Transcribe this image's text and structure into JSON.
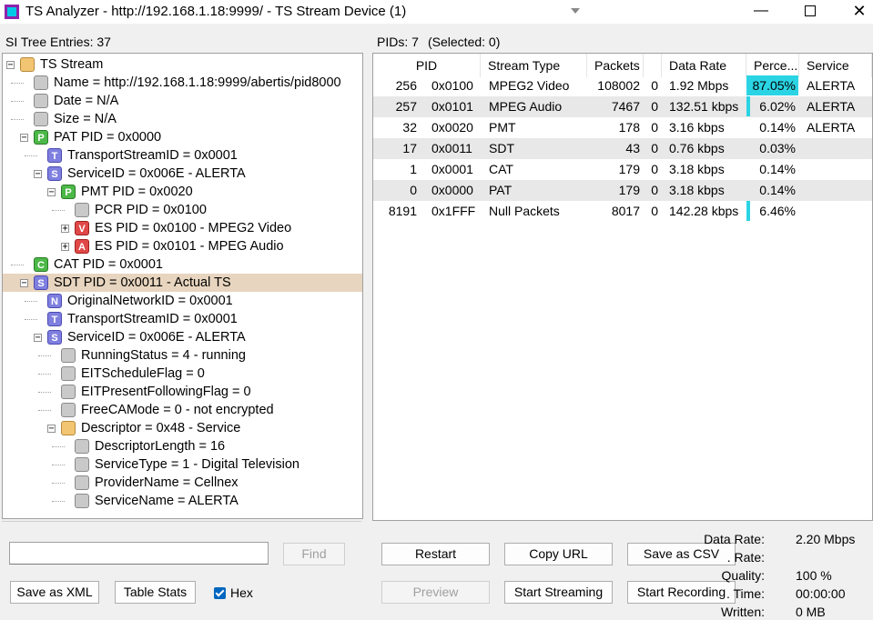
{
  "window": {
    "title": "TS Analyzer - http://192.168.1.18:9999/ - TS Stream Device (1)"
  },
  "left_header": "SI Tree Entries: 37",
  "right_header": {
    "pids": "PIDs: 7",
    "selected": "(Selected: 0)"
  },
  "tree": {
    "items": [
      {
        "label": "TS Stream",
        "icon": "folder",
        "glyph": ""
      },
      {
        "label": "Name = http://192.168.1.18:9999/abertis/pid8000",
        "icon": "item",
        "glyph": ""
      },
      {
        "label": "Date = N/A",
        "icon": "item",
        "glyph": ""
      },
      {
        "label": "Size = N/A",
        "icon": "item",
        "glyph": ""
      },
      {
        "label": "PAT PID = 0x0000",
        "icon": "P",
        "glyph": "P"
      },
      {
        "label": "TransportStreamID = 0x0001",
        "icon": "T",
        "glyph": "T"
      },
      {
        "label": "ServiceID = 0x006E - ALERTA",
        "icon": "S",
        "glyph": "S"
      },
      {
        "label": "PMT PID = 0x0020",
        "icon": "P",
        "glyph": "P"
      },
      {
        "label": "PCR PID = 0x0100",
        "icon": "item",
        "glyph": ""
      },
      {
        "label": "ES PID = 0x0100 - MPEG2 Video",
        "icon": "V",
        "glyph": "V"
      },
      {
        "label": "ES PID = 0x0101 - MPEG Audio",
        "icon": "A",
        "glyph": "A"
      },
      {
        "label": "CAT PID = 0x0001",
        "icon": "C",
        "glyph": "C"
      },
      {
        "label": "SDT PID = 0x0011 - Actual TS",
        "icon": "S",
        "glyph": "S"
      },
      {
        "label": "OriginalNetworkID = 0x0001",
        "icon": "N",
        "glyph": "N"
      },
      {
        "label": "TransportStreamID = 0x0001",
        "icon": "T",
        "glyph": "T"
      },
      {
        "label": "ServiceID = 0x006E - ALERTA",
        "icon": "S",
        "glyph": "S"
      },
      {
        "label": "RunningStatus = 4 - running",
        "icon": "item",
        "glyph": ""
      },
      {
        "label": "EITScheduleFlag = 0",
        "icon": "item",
        "glyph": ""
      },
      {
        "label": "EITPresentFollowingFlag = 0",
        "icon": "item",
        "glyph": ""
      },
      {
        "label": "FreeCAMode = 0 - not encrypted",
        "icon": "item",
        "glyph": ""
      },
      {
        "label": "Descriptor = 0x48 - Service",
        "icon": "folder",
        "glyph": ""
      },
      {
        "label": "DescriptorLength = 16",
        "icon": "item",
        "glyph": ""
      },
      {
        "label": "ServiceType = 1 - Digital Television",
        "icon": "item",
        "glyph": ""
      },
      {
        "label": "ProviderName = Cellnex",
        "icon": "item",
        "glyph": ""
      },
      {
        "label": "ServiceName = ALERTA",
        "icon": "item",
        "glyph": ""
      }
    ],
    "expander_minus": "−",
    "expander_plus": "+"
  },
  "pid_table": {
    "columns": [
      "PID",
      "Stream Type",
      "Packets",
      "Data Rate",
      "Perce...",
      "Service"
    ],
    "rows": [
      {
        "pid": "256",
        "hex": "0x0100",
        "type": "MPEG2 Video",
        "packets": "108002",
        "cc": "0",
        "rate": "1.92 Mbps",
        "percent": "87.05%",
        "percent_value": 87.05,
        "service": "ALERTA"
      },
      {
        "pid": "257",
        "hex": "0x0101",
        "type": "MPEG Audio",
        "packets": "7467",
        "cc": "0",
        "rate": "132.51 kbps",
        "percent": "6.02%",
        "percent_value": 6.02,
        "service": "ALERTA"
      },
      {
        "pid": "32",
        "hex": "0x0020",
        "type": "PMT",
        "packets": "178",
        "cc": "0",
        "rate": "3.16 kbps",
        "percent": "0.14%",
        "percent_value": 0.14,
        "service": "ALERTA"
      },
      {
        "pid": "17",
        "hex": "0x0011",
        "type": "SDT",
        "packets": "43",
        "cc": "0",
        "rate": "0.76 kbps",
        "percent": "0.03%",
        "percent_value": 0.03,
        "service": ""
      },
      {
        "pid": "1",
        "hex": "0x0001",
        "type": "CAT",
        "packets": "179",
        "cc": "0",
        "rate": "3.18 kbps",
        "percent": "0.14%",
        "percent_value": 0.14,
        "service": ""
      },
      {
        "pid": "0",
        "hex": "0x0000",
        "type": "PAT",
        "packets": "179",
        "cc": "0",
        "rate": "3.18 kbps",
        "percent": "0.14%",
        "percent_value": 0.14,
        "service": ""
      },
      {
        "pid": "8191",
        "hex": "0x1FFF",
        "type": "Null Packets",
        "packets": "8017",
        "cc": "0",
        "rate": "142.28 kbps",
        "percent": "6.46%",
        "percent_value": 6.46,
        "service": ""
      }
    ],
    "bar_color": "#2bd4e4"
  },
  "left_controls": {
    "find_value": "",
    "find_label": "Find",
    "save_xml_label": "Save as XML",
    "table_stats_label": "Table Stats",
    "hex_label": "Hex",
    "hex_checked": true
  },
  "right_controls": {
    "restart_label": "Restart",
    "copy_url_label": "Copy URL",
    "save_csv_label": "Save as CSV",
    "preview_label": "Preview",
    "start_streaming_label": "Start Streaming",
    "start_recording_label": "Start Recording"
  },
  "stats": [
    {
      "label": "Data Rate:",
      "value": "2.20 Mbps"
    },
    {
      "label": ". Rate:",
      "value": ""
    },
    {
      "label": "Quality:",
      "value": "100 %"
    },
    {
      "label": ". Time:",
      "value": "00:00:00"
    },
    {
      "label": "Written:",
      "value": "0 MB"
    }
  ],
  "accent_color": "#0067c0",
  "selection_color": "#e8d5bf"
}
